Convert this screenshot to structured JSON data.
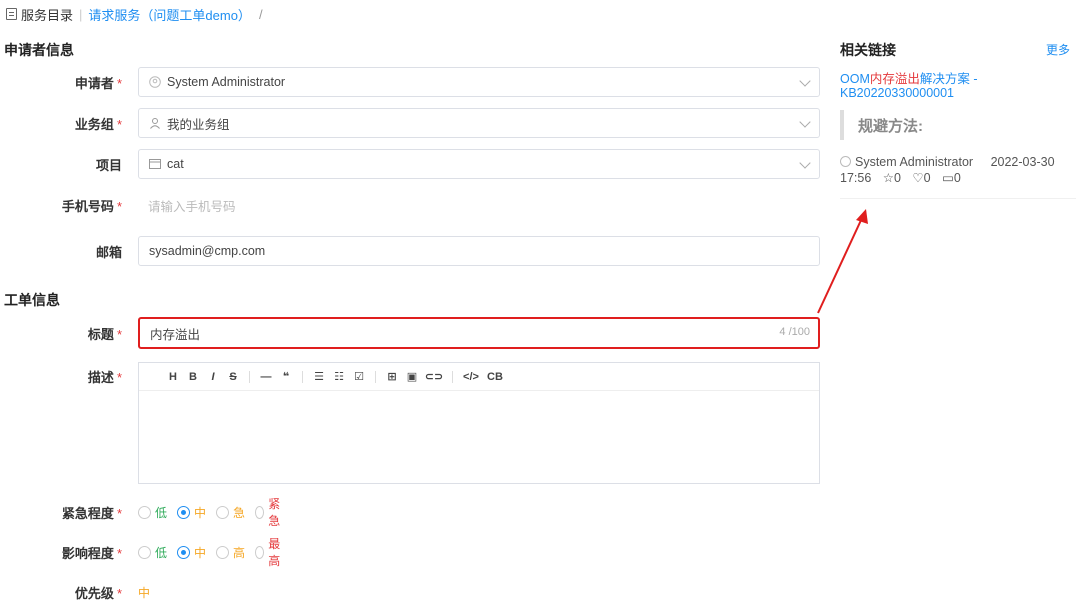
{
  "breadcrumb": {
    "root": "服务目录",
    "link": "请求服务（问题工单demo）",
    "slash": "/"
  },
  "sections": {
    "applicant": "申请者信息",
    "ticket": "工单信息"
  },
  "fields": {
    "applicant": {
      "label": "申请者",
      "value": "System Administrator"
    },
    "group": {
      "label": "业务组",
      "value": "我的业务组"
    },
    "project": {
      "label": "项目",
      "value": "cat"
    },
    "phone": {
      "label": "手机号码",
      "placeholder": "请输入手机号码"
    },
    "email": {
      "label": "邮箱",
      "value": "sysadmin@cmp.com"
    },
    "title": {
      "label": "标题",
      "value": "内存溢出",
      "counter": "4 /100"
    },
    "desc": {
      "label": "描述"
    },
    "urgency": {
      "label": "紧急程度",
      "options": [
        "低",
        "中",
        "急",
        "紧急"
      ],
      "selected": 1
    },
    "impact": {
      "label": "影响程度",
      "options": [
        "低",
        "中",
        "高",
        "最高"
      ],
      "selected": 1
    },
    "priority": {
      "label": "优先级",
      "value": "中"
    }
  },
  "required_mark": "*",
  "toolbar": [
    "H",
    "B",
    "I",
    "S",
    "—",
    "❝",
    "☰",
    "☷",
    "☑",
    "⊞",
    "▣",
    "⊂⊃",
    "</>",
    "CB"
  ],
  "sidebar": {
    "title": "相关链接",
    "more": "更多",
    "kb_prefix": "OOM",
    "kb_highlight": "内存溢出",
    "kb_suffix": "解决方案 -",
    "kb_id": "KB20220330000001",
    "quote": "规避方法:",
    "author": "System Administrator",
    "date": "2022-03-30",
    "time": "17:56",
    "stars": "0",
    "likes": "0",
    "comments": "0"
  },
  "colors": {
    "accent": "#1f8ef1",
    "highlight_border": "#e01e1e",
    "low": "#2eab5a",
    "mid": "#f5a623",
    "high": "#e4393c"
  }
}
